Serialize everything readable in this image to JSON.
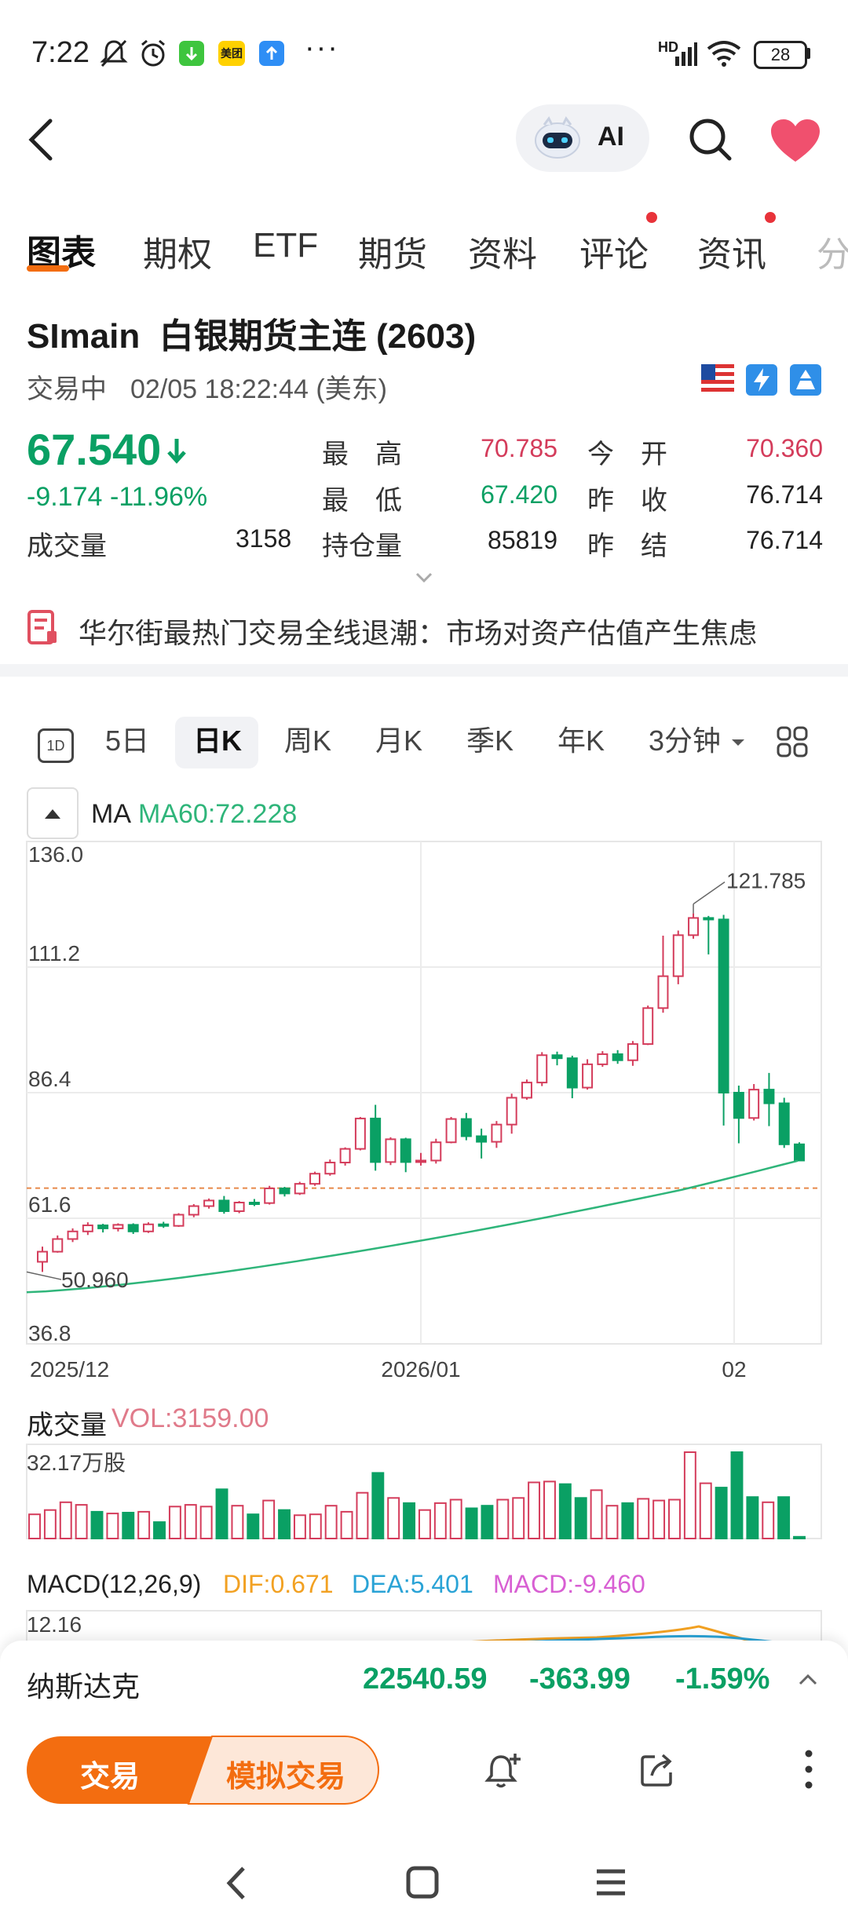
{
  "status_bar": {
    "time": "7:22",
    "battery": "28",
    "network": "HD"
  },
  "header": {
    "ai_label": "AI"
  },
  "tabs": [
    {
      "label": "图表",
      "active": true,
      "dot": false
    },
    {
      "label": "期权",
      "active": false,
      "dot": false
    },
    {
      "label": "ETF",
      "active": false,
      "dot": false
    },
    {
      "label": "期货",
      "active": false,
      "dot": false
    },
    {
      "label": "资料",
      "active": false,
      "dot": false
    },
    {
      "label": "评论",
      "active": false,
      "dot": true
    },
    {
      "label": "资讯",
      "active": false,
      "dot": true
    },
    {
      "label": "分",
      "active": false,
      "dot": false
    }
  ],
  "quote": {
    "title": "SImain  白银期货主连 (2603)",
    "status": "交易中",
    "datetime": "02/05 18:22:44 (美东)",
    "price": "67.540",
    "change": "-9.174",
    "change_pct": "-11.96%",
    "volume_label": "成交量",
    "volume": "3158",
    "high_label": "最　高",
    "high": "70.785",
    "low_label": "最　低",
    "low": "67.420",
    "oi_label": "持仓量",
    "oi": "85819",
    "open_label": "今　开",
    "open": "70.360",
    "prev_close_label": "昨　收",
    "prev_close": "76.714",
    "prev_settle_label": "昨　结",
    "prev_settle": "76.714"
  },
  "news": {
    "headline": "华尔街最热门交易全线退潮：市场对资产估值产生焦虑"
  },
  "kline_tabs": {
    "icon_1d": "1D",
    "items": [
      "5日",
      "日K",
      "周K",
      "月K",
      "季K",
      "年K"
    ],
    "active": "日K",
    "interval": "3分钟"
  },
  "ma": {
    "label": "MA",
    "ma60": "MA60:72.228"
  },
  "chart_data": {
    "type": "candlestick",
    "y_ticks": [
      "136.0",
      "111.2",
      "86.4",
      "61.6",
      "36.8"
    ],
    "ylim": [
      36.8,
      136.0
    ],
    "x_ticks": [
      "2025/12",
      "2026/01",
      "02"
    ],
    "high_annotation": "121.785",
    "low_annotation": "50.960",
    "current_price": 67.54,
    "candles": [
      [
        53.0,
        55.0,
        51.0,
        56.0
      ],
      [
        55.0,
        57.5,
        54.8,
        58.2
      ],
      [
        57.5,
        59.0,
        56.9,
        59.6
      ],
      [
        59.0,
        60.2,
        58.3,
        60.8
      ],
      [
        60.2,
        59.6,
        58.8,
        60.5
      ],
      [
        59.6,
        60.3,
        59.0,
        60.6
      ],
      [
        60.3,
        59.0,
        58.5,
        60.6
      ],
      [
        59.0,
        60.4,
        58.7,
        60.8
      ],
      [
        60.4,
        60.1,
        59.7,
        60.9
      ],
      [
        60.1,
        62.3,
        59.9,
        62.6
      ],
      [
        62.3,
        64.0,
        61.8,
        64.4
      ],
      [
        64.0,
        65.1,
        63.5,
        65.5
      ],
      [
        65.1,
        63.0,
        62.5,
        66.0
      ],
      [
        63.0,
        64.7,
        62.6,
        65.0
      ],
      [
        64.7,
        64.6,
        64.0,
        65.4
      ],
      [
        64.6,
        67.5,
        64.3,
        68.0
      ],
      [
        67.5,
        66.5,
        65.9,
        67.8
      ],
      [
        66.5,
        68.4,
        66.2,
        68.8
      ],
      [
        68.4,
        70.4,
        68.0,
        70.8
      ],
      [
        70.4,
        72.6,
        70.0,
        73.2
      ],
      [
        72.6,
        75.3,
        72.0,
        75.6
      ],
      [
        75.3,
        81.3,
        75.0,
        81.6
      ],
      [
        81.3,
        72.7,
        71.0,
        84.0
      ],
      [
        72.7,
        77.2,
        72.1,
        77.6
      ],
      [
        77.2,
        72.7,
        70.7,
        77.5
      ],
      [
        72.7,
        73.0,
        72.0,
        74.5
      ],
      [
        73.0,
        76.6,
        72.4,
        77.3
      ],
      [
        76.6,
        81.2,
        76.4,
        81.6
      ],
      [
        81.2,
        77.8,
        77.0,
        82.4
      ],
      [
        77.8,
        76.7,
        73.4,
        79.3
      ],
      [
        76.7,
        80.1,
        75.5,
        80.8
      ],
      [
        80.1,
        85.4,
        78.3,
        86.2
      ],
      [
        85.4,
        88.4,
        85.0,
        89.0
      ],
      [
        88.4,
        93.8,
        87.7,
        94.4
      ],
      [
        93.8,
        93.2,
        91.8,
        94.5
      ],
      [
        93.2,
        87.4,
        85.3,
        93.7
      ],
      [
        87.4,
        92.0,
        87.0,
        93.0
      ],
      [
        92.0,
        94.0,
        91.5,
        94.6
      ],
      [
        94.0,
        92.8,
        92.1,
        94.8
      ],
      [
        92.8,
        96.0,
        91.7,
        96.6
      ],
      [
        96.0,
        103.1,
        95.8,
        103.6
      ],
      [
        103.1,
        109.4,
        102.2,
        117.4
      ],
      [
        109.4,
        117.5,
        107.8,
        118.4
      ],
      [
        117.5,
        120.9,
        116.8,
        121.8
      ],
      [
        120.9,
        120.6,
        113.7,
        121.3
      ],
      [
        120.6,
        86.4,
        79.9,
        121.5
      ],
      [
        86.4,
        81.4,
        76.4,
        87.8
      ],
      [
        81.4,
        87.0,
        80.9,
        88.1
      ],
      [
        87.0,
        84.3,
        79.8,
        90.3
      ],
      [
        84.3,
        76.2,
        75.5,
        85.4
      ],
      [
        76.2,
        73.0,
        72.9,
        76.6
      ]
    ],
    "ma60_start": 47.0,
    "ma60_end": 72.2,
    "grid": true
  },
  "volume": {
    "label": "成交量",
    "vol": "VOL:3159.00",
    "max_label": "32.17万股",
    "bars": [
      0.28,
      0.33,
      0.42,
      0.39,
      0.31,
      0.29,
      0.3,
      0.31,
      0.19,
      0.37,
      0.39,
      0.37,
      0.57,
      0.38,
      0.28,
      0.44,
      0.33,
      0.27,
      0.28,
      0.38,
      0.31,
      0.53,
      0.76,
      0.47,
      0.41,
      0.33,
      0.41,
      0.45,
      0.35,
      0.38,
      0.45,
      0.47,
      0.65,
      0.66,
      0.63,
      0.47,
      0.56,
      0.38,
      0.41,
      0.46,
      0.44,
      0.45,
      1.0,
      0.64,
      0.59,
      1.0,
      0.48,
      0.42,
      0.48,
      0.02
    ]
  },
  "macd": {
    "label": "MACD(12,26,9)",
    "dif": "DIF:0.671",
    "dea": "DEA:5.401",
    "macd": "MACD:-9.460",
    "top": "12.16"
  },
  "ticker": {
    "name": "纳斯达克",
    "price": "22540.59",
    "change": "-363.99",
    "pct": "-1.59%"
  },
  "actions": {
    "trade": "交易",
    "sim_trade": "模拟交易"
  },
  "colors": {
    "up": "#d43c5b",
    "down": "#0aa064",
    "accent": "#f36d10",
    "ma60": "#2fb57a",
    "dif": "#f2a122",
    "dea": "#2aa3d6",
    "macd": "#d85fd3"
  }
}
